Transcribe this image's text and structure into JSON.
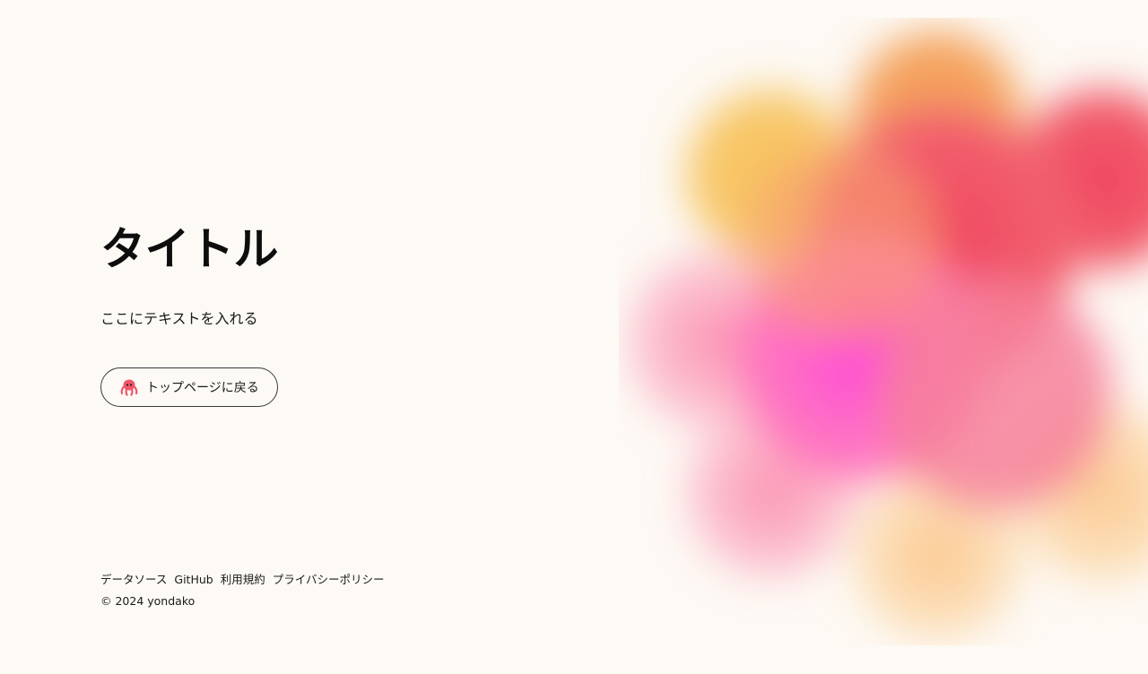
{
  "main": {
    "title": "タイトル",
    "text": "ここにテキストを入れる",
    "back_button_label": "トップページに戻る",
    "back_button_icon": "octopus-icon"
  },
  "footer": {
    "links": [
      {
        "label": "データソース"
      },
      {
        "label": "GitHub"
      },
      {
        "label": "利用規約"
      },
      {
        "label": "プライバシーポリシー"
      }
    ],
    "copyright": "© 2024 yondako"
  },
  "colors": {
    "background": "#fdf9f4",
    "blob_yellow": "#f6c35a",
    "blob_red": "#f0445f",
    "blob_magenta": "#ff4fd8",
    "blob_peach": "#fbc98a"
  }
}
